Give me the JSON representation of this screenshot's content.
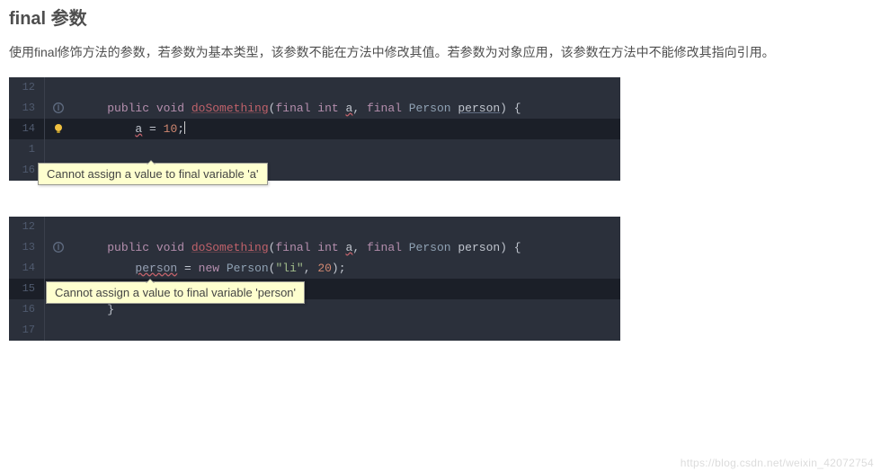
{
  "heading": "final 参数",
  "paragraph": "使用final修饰方法的参数，若参数为基本类型，该参数不能在方法中修改其值。若参数为对象应用，该参数在方法中不能修改其指向引用。",
  "block1": {
    "lines": {
      "l12": "12",
      "l13": "13",
      "l14": "14",
      "l15": "1",
      "l16": "16"
    },
    "code": {
      "sig_kw1": "public ",
      "sig_kw2": "void ",
      "sig_fn": "doSomething",
      "sig_open": "(",
      "sig_kw3": "final ",
      "sig_ty1": "int ",
      "sig_p1": "a",
      "sig_comma": ", ",
      "sig_kw4": "final ",
      "sig_ty2": "Person ",
      "sig_p2": "person",
      "sig_close": ") {",
      "l14_lhs": "a",
      "l14_eq": " = ",
      "l14_rhs": "10",
      "l14_semi": ";"
    },
    "tooltip": "Cannot assign a value to final variable 'a'"
  },
  "block2": {
    "lines": {
      "l12": "12",
      "l13": "13",
      "l14": "14",
      "l15": "15",
      "l16": "16",
      "l17": "17"
    },
    "code": {
      "sig_kw1": "public ",
      "sig_kw2": "void ",
      "sig_fn": "doSomething",
      "sig_open": "(",
      "sig_kw3": "final ",
      "sig_ty1": "int ",
      "sig_p1": "a",
      "sig_comma": ", ",
      "sig_kw4": "final ",
      "sig_ty2": "Person ",
      "sig_p2": "person",
      "sig_close": ") {",
      "l14_lhs": "person",
      "l14_eq": " = ",
      "l14_new": "new ",
      "l14_ty": "Person",
      "l14_open": "(",
      "l14_str": "\"li\"",
      "l14_comma": ", ",
      "l14_num": "20",
      "l14_close": ");",
      "l16_text": "    }"
    },
    "tooltip": "Cannot assign a value to final variable 'person'"
  },
  "watermark": "https://blog.csdn.net/weixin_42072754"
}
